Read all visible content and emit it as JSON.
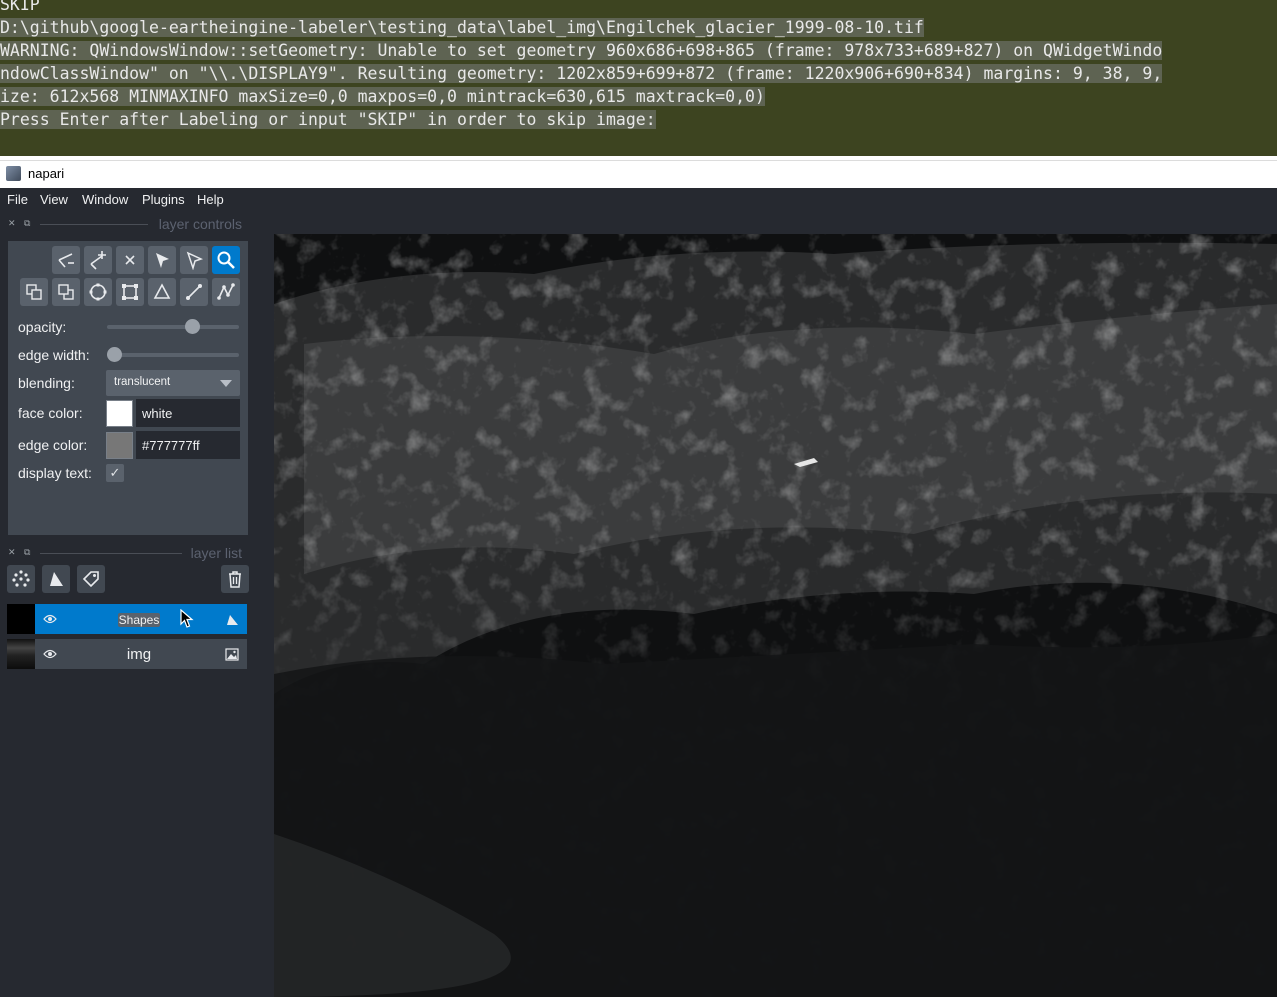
{
  "terminal": {
    "lines": [
      "SKIP",
      "D:\\github\\google-eartheingine-labeler\\testing_data\\label_img\\Engilchek_glacier_1999-08-10.tif",
      "WARNING: QWindowsWindow::setGeometry: Unable to set geometry 960x686+698+865 (frame: 978x733+689+827) on QWidgetWindo",
      "ndowClassWindow\" on \"\\\\.\\DISPLAY9\". Resulting geometry: 1202x859+699+872 (frame: 1220x906+690+834) margins: 9, 38, 9,",
      "ize: 612x568 MINMAXINFO maxSize=0,0 maxpos=0,0 mintrack=630,615 maxtrack=0,0)",
      "Press Enter after Labeling or input \"SKIP\" in order to skip image:"
    ]
  },
  "window": {
    "title": "napari"
  },
  "menubar": {
    "items": [
      "File",
      "View",
      "Window",
      "Plugins",
      "Help"
    ]
  },
  "layer_controls": {
    "header": "layer controls",
    "opacity": {
      "label": "opacity:",
      "value": 0.67
    },
    "edge_width": {
      "label": "edge width:",
      "value": 0.0
    },
    "blending": {
      "label": "blending:",
      "value": "translucent"
    },
    "face_color": {
      "label": "face color:",
      "value": "white",
      "swatch": "#ffffff"
    },
    "edge_color": {
      "label": "edge color:",
      "value": "#777777ff",
      "swatch": "#777777"
    },
    "display_text": {
      "label": "display text:",
      "checked": true,
      "check_glyph": "✓"
    },
    "tools_row1": [
      "remove-vertex-icon",
      "add-vertex-icon",
      "delete-shape-icon",
      "select-shape-icon",
      "select-vertex-icon",
      "pan-zoom-icon"
    ],
    "tools_row2": [
      "move-back-icon",
      "move-front-icon",
      "ellipse-icon",
      "rectangle-icon",
      "polygon-icon",
      "line-icon",
      "path-icon"
    ],
    "active_tool": "pan-zoom-icon"
  },
  "layer_list": {
    "header": "layer list",
    "buttons": [
      "new-points-icon",
      "new-shapes-icon",
      "new-labels-icon"
    ],
    "delete_button": "trash-icon",
    "layers": [
      {
        "name": "Shapes",
        "visible": true,
        "selected": true,
        "type_icon": "shapes-type-icon"
      },
      {
        "name": "img",
        "visible": true,
        "selected": false,
        "type_icon": "image-type-icon"
      }
    ]
  },
  "colors": {
    "accent": "#007acc",
    "background": "#262930",
    "panel": "#414851",
    "terminal": "#3d4420"
  }
}
